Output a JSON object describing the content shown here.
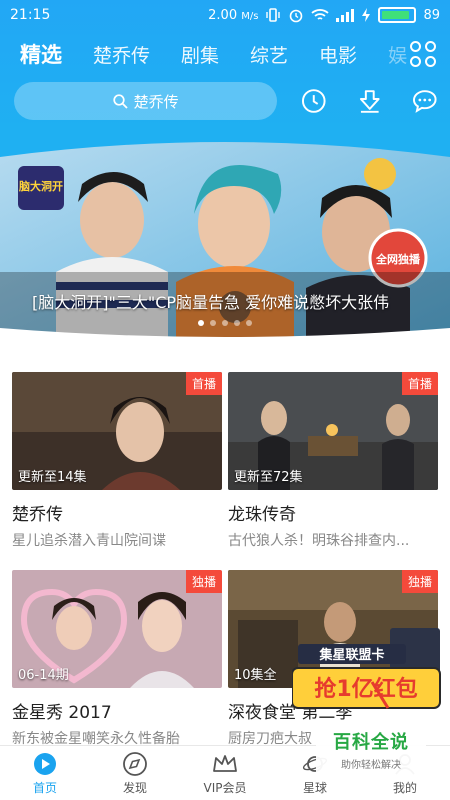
{
  "status": {
    "time": "21:15",
    "speed": "2.00",
    "speed_unit": "M/s",
    "battery": "89",
    "battery_level": 0.89
  },
  "tabs": [
    {
      "label": "精选",
      "active": true
    },
    {
      "label": "楚乔传"
    },
    {
      "label": "剧集"
    },
    {
      "label": "综艺"
    },
    {
      "label": "电影"
    },
    {
      "label": "娱"
    }
  ],
  "search": {
    "query": "楚乔传"
  },
  "header_icons": [
    "history-clock-icon",
    "download-icon",
    "message-icon"
  ],
  "banner": {
    "caption": "[脑大洞开]\"三大\"CP脑量告急 爱你难说憋坏大张伟",
    "logo_text": "脑大洞开",
    "badge_text": "全网独播",
    "dots_count": 5,
    "active_dot": 0
  },
  "cards": [
    {
      "title": "楚乔传",
      "subtitle": "星儿追杀潜入青山院间谍",
      "episode": "更新至14集",
      "corner": "首播"
    },
    {
      "title": "龙珠传奇",
      "subtitle": "古代狼人杀！明珠谷排查内...",
      "episode": "更新至72集",
      "corner": "首播"
    },
    {
      "title": "金星秀 2017",
      "subtitle": "新东被金星嘲笑永久性备胎",
      "episode": "06-14期",
      "corner": "独播"
    },
    {
      "title": "深夜食堂 第二季",
      "subtitle": "厨房刀疤大叔",
      "episode": "10集全",
      "corner": "独播"
    }
  ],
  "promo": {
    "line1": "集星联盟卡",
    "line2": "抢1亿红包"
  },
  "watermark": {
    "title": "百科全说",
    "subtitle": "助你轻松解决"
  },
  "bottom_nav": [
    {
      "label": "首页",
      "icon": "home-icon",
      "active": true
    },
    {
      "label": "发现",
      "icon": "compass-icon"
    },
    {
      "label": "VIP会员",
      "icon": "crown-icon"
    },
    {
      "label": "星球",
      "icon": "planet-icon"
    },
    {
      "label": "我的",
      "icon": "profile-icon"
    }
  ],
  "colors": {
    "accent": "#1aa3ef",
    "header": "#22a7f5",
    "badge": "#f44a3b",
    "promo": "#e63b2e"
  }
}
